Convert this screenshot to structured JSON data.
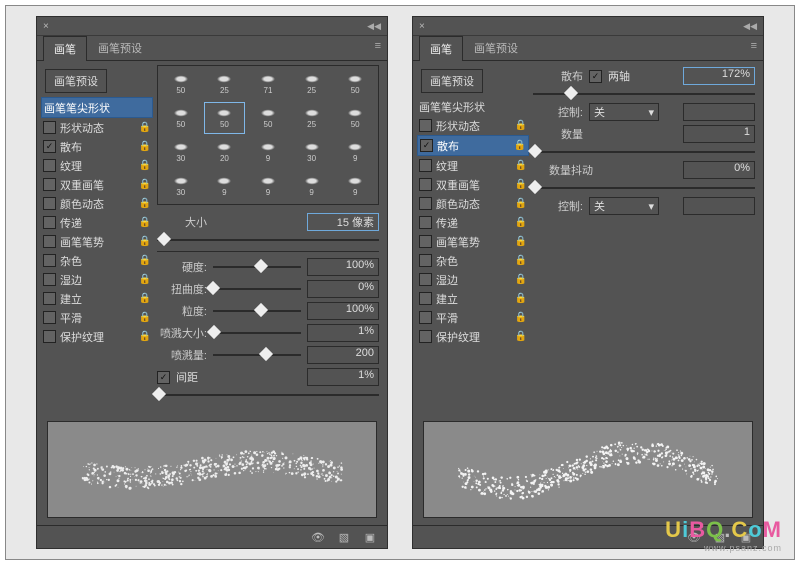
{
  "close_glyph": "×",
  "collapse_glyph": "◀◀",
  "menu_glyph": "≡",
  "lock_glyph": "🔒",
  "tabs": {
    "brush": "画笔",
    "presets": "画笔预设"
  },
  "preset_button": "画笔预设",
  "sidebar": {
    "tip_shape": "画笔笔尖形状",
    "items": [
      {
        "label": "形状动态",
        "checked": false
      },
      {
        "label": "散布",
        "checked": true
      },
      {
        "label": "纹理",
        "checked": false
      },
      {
        "label": "双重画笔",
        "checked": false
      },
      {
        "label": "颜色动态",
        "checked": false
      },
      {
        "label": "传递",
        "checked": false
      },
      {
        "label": "画笔笔势",
        "checked": false
      },
      {
        "label": "杂色",
        "checked": false
      },
      {
        "label": "湿边",
        "checked": false
      },
      {
        "label": "建立",
        "checked": false
      },
      {
        "label": "平滑",
        "checked": false
      },
      {
        "label": "保护纹理",
        "checked": false
      }
    ]
  },
  "left": {
    "tip_sizes": [
      50,
      25,
      71,
      25,
      50,
      50,
      50,
      50,
      25,
      50,
      30,
      20,
      9,
      30,
      9,
      30,
      9,
      9,
      9,
      9
    ],
    "selected_tip": 6,
    "size_label": "大小",
    "size_value": "15 像素",
    "sliders": [
      {
        "label": "硬度:",
        "value": "100%",
        "pos": 55
      },
      {
        "label": "扭曲度:",
        "value": "0%",
        "pos": 0
      },
      {
        "label": "粒度:",
        "value": "100%",
        "pos": 55
      },
      {
        "label": "喷溅大小:",
        "value": "1%",
        "pos": 1
      },
      {
        "label": "喷溅量:",
        "value": "200",
        "pos": 60
      }
    ],
    "spacing_label": "间距",
    "spacing_checked": true,
    "spacing_value": "1%"
  },
  "right": {
    "scatter_label": "散布",
    "both_axes_label": "两轴",
    "both_axes_checked": true,
    "scatter_value": "172%",
    "control_label": "控制:",
    "control_value": "关",
    "count_label": "数量",
    "count_value": "1",
    "jitter_label": "数量抖动",
    "jitter_value": "0%",
    "control2_value": "关"
  },
  "footer_icons": [
    "eye-toggle-icon",
    "new-icon",
    "trash-icon"
  ],
  "watermark_chars": [
    {
      "c": "U",
      "col": "#e4c84a"
    },
    {
      "c": "i",
      "col": "#4ecad8"
    },
    {
      "c": "B",
      "col": "#e85aa0"
    },
    {
      "c": "Q",
      "col": "#7cc04a"
    },
    {
      "c": ".",
      "col": "#bbb"
    },
    {
      "c": "C",
      "col": "#e4c84a"
    },
    {
      "c": "o",
      "col": "#4ecad8"
    },
    {
      "c": "M",
      "col": "#e85aa0"
    }
  ],
  "watermark_sub": "www.psanz.com"
}
